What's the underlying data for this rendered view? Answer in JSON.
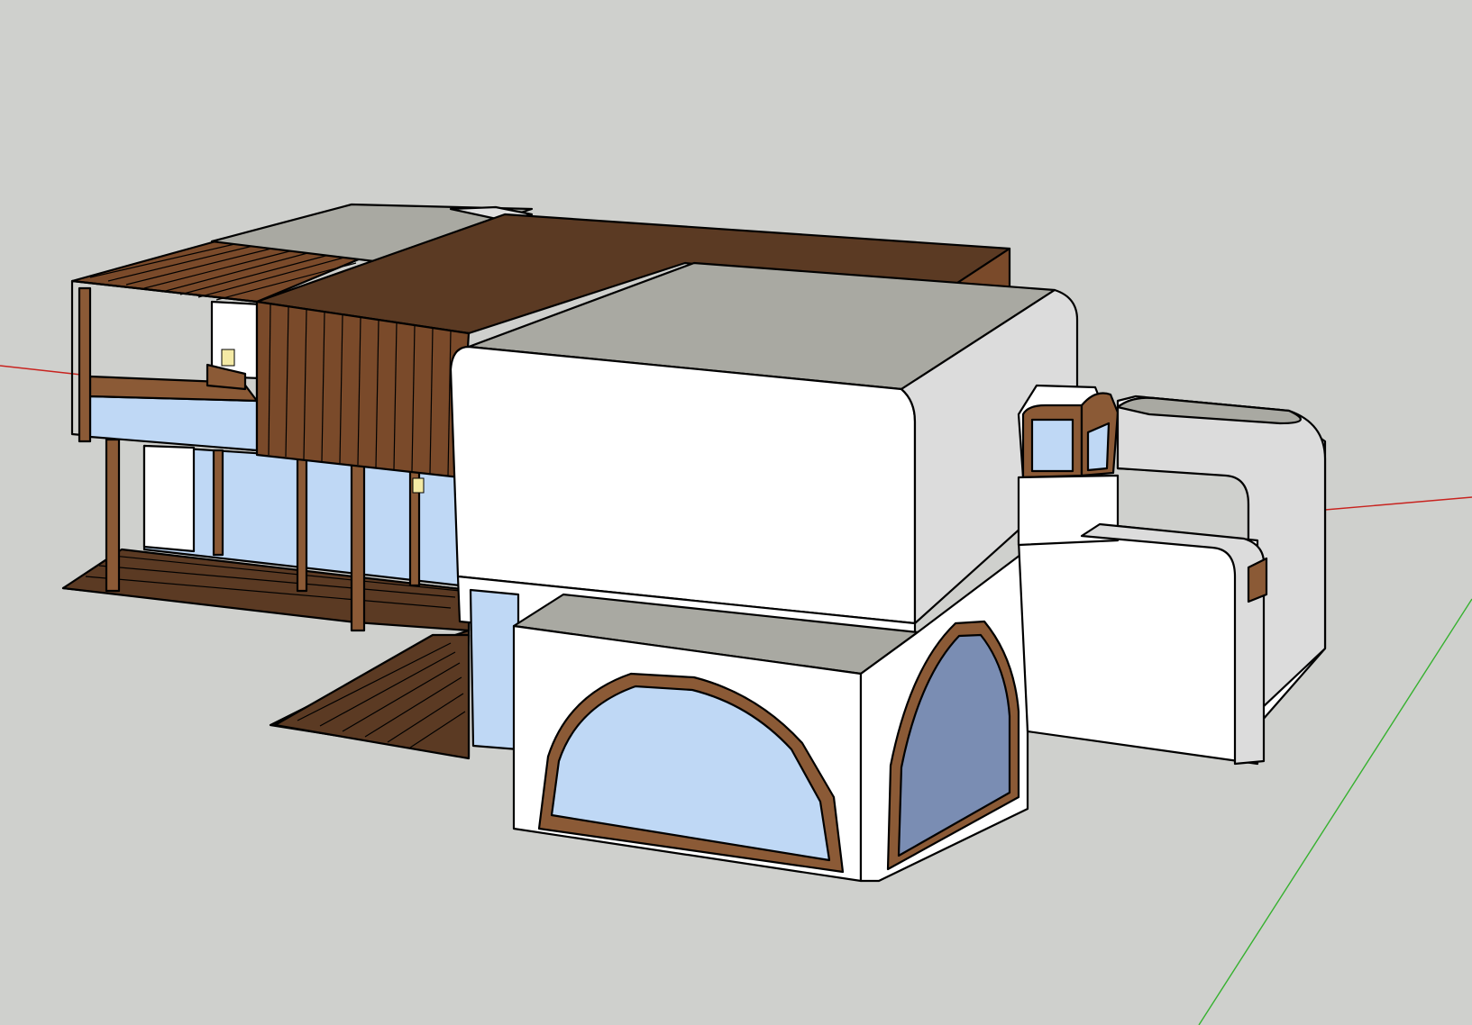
{
  "viewport": {
    "background_color": "#cfd0cd"
  },
  "axes": {
    "red_axis_color": "#c8231f",
    "green_axis_color": "#36b12f"
  },
  "materials": {
    "wood_dark": "#5b3a23",
    "wood_mid": "#7a4a2a",
    "wood_frame": "#8b5a36",
    "wall_white": "#ffffff",
    "wall_shade": "#dcdcdc",
    "roof_gray": "#a9a9a2",
    "glass_light": "#bfd8f5",
    "glass_dark": "#7a8db3",
    "lamp_yellow": "#f4eaa5"
  }
}
